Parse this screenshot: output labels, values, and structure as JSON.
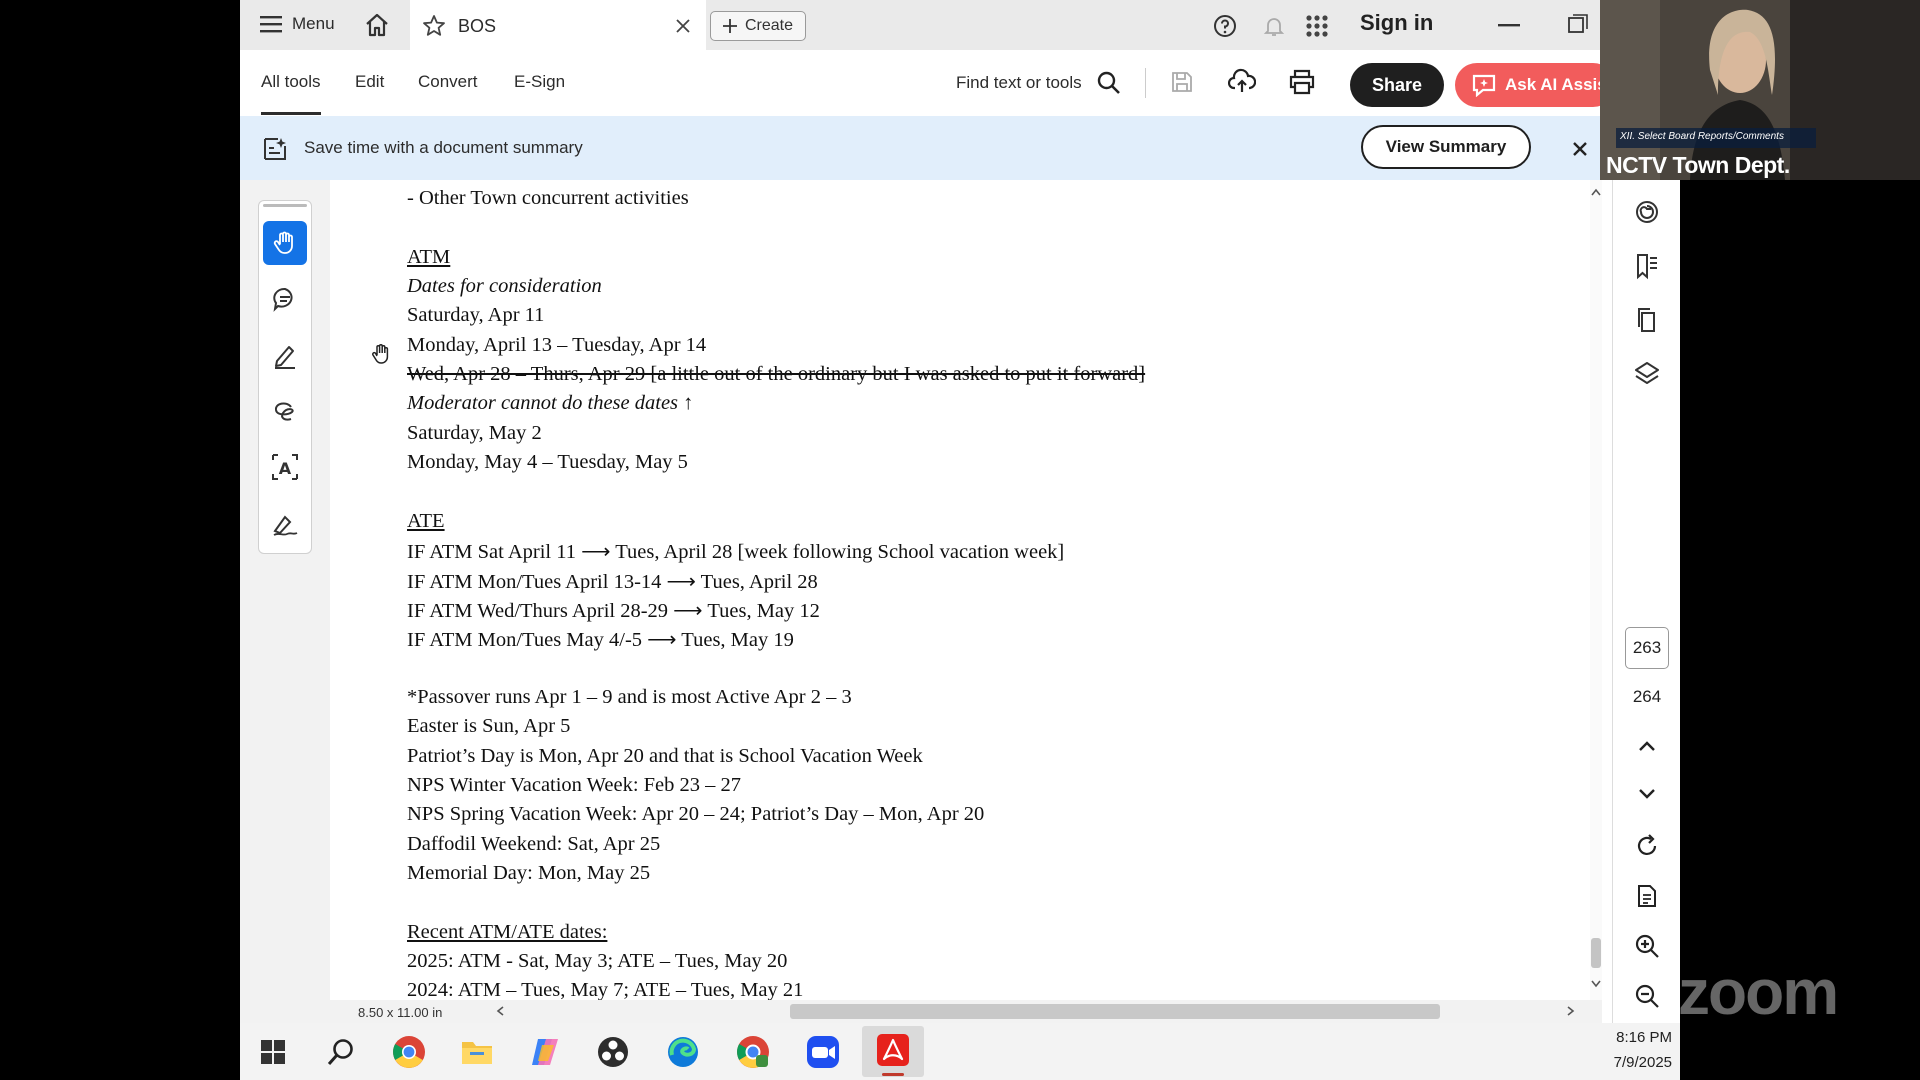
{
  "tabbar": {
    "menu_label": "Menu",
    "tab_title": "BOS",
    "create_label": "Create",
    "signin_label": "Sign in"
  },
  "toolbar": {
    "tabs": [
      "All tools",
      "Edit",
      "Convert",
      "E-Sign"
    ],
    "find_label": "Find text or tools",
    "share_label": "Share",
    "ai_label": "Ask AI Assis"
  },
  "banner": {
    "text": "Save time with a document summary",
    "button_label": "View Summary"
  },
  "document": {
    "lines": [
      {
        "text": "- Other Town concurrent activities",
        "style": "normal"
      },
      {
        "text": "",
        "style": "normal"
      },
      {
        "text": "ATM",
        "style": "underline"
      },
      {
        "text": "Dates for consideration",
        "style": "italic"
      },
      {
        "text": "Saturday, Apr 11",
        "style": "normal"
      },
      {
        "text": "Monday, April 13 – Tuesday, Apr 14",
        "style": "normal"
      },
      {
        "text": "Wed, Apr 28 – Thurs, Apr 29 [a little out of the ordinary but I was asked to put it forward]",
        "style": "strike"
      },
      {
        "text": "Moderator cannot do these dates ↑",
        "style": "italic"
      },
      {
        "text": "Saturday, May 2",
        "style": "normal"
      },
      {
        "text": "Monday, May 4 – Tuesday, May 5",
        "style": "normal"
      },
      {
        "text": "",
        "style": "normal"
      },
      {
        "text": "ATE",
        "style": "underline"
      },
      {
        "text": "IF ATM Sat April 11 ⟶ Tues, April 28 [week following School vacation week]",
        "style": "normal"
      },
      {
        "text": "IF ATM Mon/Tues April 13-14 ⟶ Tues, April 28",
        "style": "normal"
      },
      {
        "text": "IF ATM Wed/Thurs April 28-29 ⟶ Tues, May 12",
        "style": "normal"
      },
      {
        "text": "IF ATM Mon/Tues May 4/-5 ⟶ Tues, May 19",
        "style": "normal"
      },
      {
        "text": "",
        "style": "normal"
      },
      {
        "text": "*Passover runs Apr 1 – 9 and is most Active Apr 2 – 3",
        "style": "normal"
      },
      {
        "text": "Easter is Sun, Apr 5",
        "style": "normal"
      },
      {
        "text": "Patriot’s Day is Mon, Apr 20 and that is School Vacation Week",
        "style": "normal"
      },
      {
        "text": "NPS Winter Vacation Week:  Feb 23 – 27",
        "style": "normal"
      },
      {
        "text": "NPS Spring Vacation Week: Apr 20 – 24; Patriot’s Day – Mon, Apr 20",
        "style": "normal"
      },
      {
        "text": "Daffodil Weekend: Sat, Apr 25",
        "style": "normal"
      },
      {
        "text": "Memorial Day: Mon, May 25",
        "style": "normal"
      },
      {
        "text": "",
        "style": "normal"
      },
      {
        "text": "Recent ATM/ATE dates:",
        "style": "underline"
      },
      {
        "text": "2025:  ATM -  Sat, May 3; ATE – Tues, May 20",
        "style": "normal"
      },
      {
        "text": "2024:  ATM – Tues, May 7; ATE – Tues, May 21",
        "style": "normal"
      }
    ]
  },
  "page_nav": {
    "current": "263",
    "next": "264"
  },
  "statusbar": {
    "page_size": "8.50 x 11.00 in"
  },
  "taskbar": {
    "time": "8:16 PM",
    "date": "7/9/2025"
  },
  "camera": {
    "label": "NCTV Town Dept.",
    "caption": "XII. Select Board Reports/Comments"
  },
  "zoom_watermark": "zoom",
  "colors": {
    "ai_button": "#f25c5c",
    "active_tool": "#1473e6",
    "banner": "#e1eefb"
  }
}
